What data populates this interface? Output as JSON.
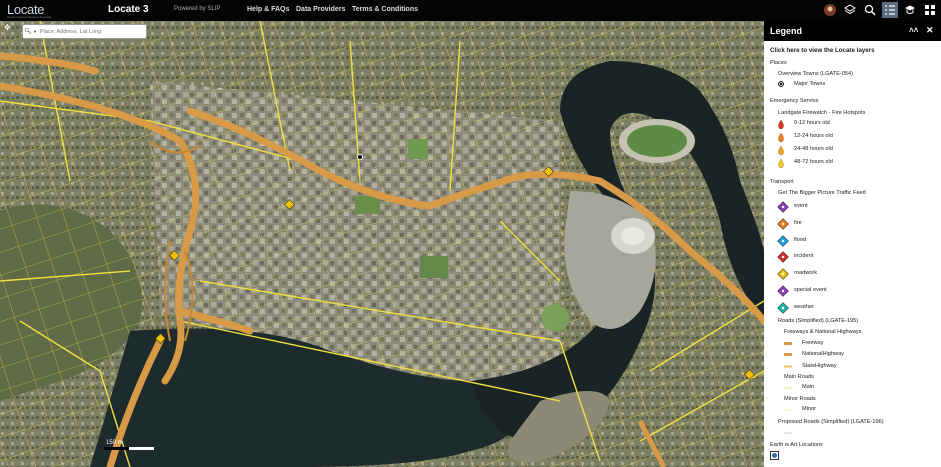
{
  "header": {
    "logo": "Locate",
    "logo_sub": "Government of Western Australia",
    "title": "Locate 3",
    "powered_by": "Powered by SLIP",
    "nav": [
      "Help & FAQs",
      "Data Providers",
      "Terms & Conditions"
    ]
  },
  "toolbar_icons": [
    "user-avatar-icon",
    "layers-icon",
    "search-icon",
    "legend-list-icon",
    "graduation-cap-icon",
    "grid-apps-icon"
  ],
  "search": {
    "placeholder": "Place, Address, Lat Long"
  },
  "map": {
    "scale_label": "150 m"
  },
  "legend": {
    "title": "Legend",
    "link": "Click here to view the Locate layers",
    "sections": {
      "places": "Places",
      "overview_towns": "Overview Towns (LGATE-054)",
      "major_towns": "Major Towns",
      "emergency": "Emergency Service",
      "firewatch": "Landgate Firewatch - Fire Hotspots",
      "fire_items": [
        "0-12 hours old",
        "12-24 hours old",
        "24-48 hours old",
        "48-72 hours old"
      ],
      "transport": "Transport",
      "traffic_feed": "Get The Bigger Picture Traffic Feed",
      "traffic_items": [
        "event",
        "fire",
        "flood",
        "incident",
        "roadwork",
        "special event",
        "weather"
      ],
      "roads": "Roads (Simplified) (LGATE-195)",
      "freeways_group": "Freeways & National Highways",
      "freeway_items": [
        "Freeway",
        "NationalHighway",
        "StateHighway"
      ],
      "main_roads": "Main Roads",
      "main": "Main",
      "minor_roads": "Minor Roads",
      "minor": "Minor",
      "proposed": "Proposed Roads (Simplified) (LGATE-196)",
      "earth_art": "Earth is Art Locations"
    }
  },
  "colors": {
    "fire": [
      "#d9341c",
      "#f07a16",
      "#f4a21a",
      "#f7c71f"
    ],
    "traffic": [
      "#8f3fc0",
      "#f07a16",
      "#1aa6e0",
      "#d92d2d",
      "#f2c200",
      "#8f3fc0",
      "#1bb7a8"
    ],
    "freeway": "#d89a47",
    "highway": "#e7c25a"
  }
}
